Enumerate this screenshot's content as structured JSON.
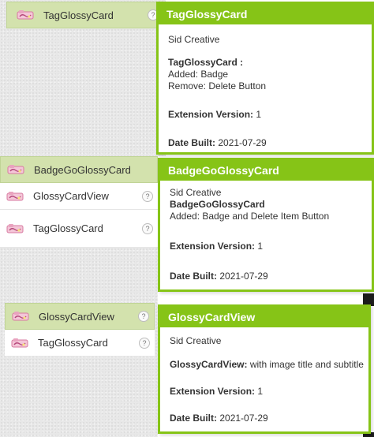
{
  "colors": {
    "accent": "#86c417",
    "selected_row": "#d3e2ad"
  },
  "icons": {
    "extension": "extension-icon",
    "help": "help-icon"
  },
  "section1": {
    "items": [
      {
        "label": "TagGlossyCard",
        "selected": true
      }
    ],
    "tooltip": {
      "title": "TagGlossyCard",
      "author": "Sid Creative",
      "desc_heading": "TagGlossyCard :",
      "desc_line1": "Added: Badge",
      "desc_line2": "Remove: Delete Button",
      "version_label": "Extension Version:",
      "version_value": "1",
      "date_label": "Date Built:",
      "date_value": "2021-07-29"
    }
  },
  "section2": {
    "items": [
      {
        "label": "BadgeGoGlossyCard",
        "selected": true
      },
      {
        "label": "GlossyCardView",
        "selected": false
      },
      {
        "label": "TagGlossyCard",
        "selected": false
      }
    ],
    "tooltip": {
      "title": "BadgeGoGlossyCard",
      "author": "Sid Creative",
      "desc_heading": "BadgeGoGlossyCard",
      "desc_line1": "Added: Badge and Delete Item Button",
      "version_label": "Extension Version:",
      "version_value": "1",
      "date_label": "Date Built:",
      "date_value": "2021-07-29"
    }
  },
  "section3": {
    "items": [
      {
        "label": "GlossyCardView",
        "selected": true
      },
      {
        "label": "TagGlossyCard",
        "selected": false
      }
    ],
    "tooltip": {
      "title": "GlossyCardView",
      "author": "Sid Creative",
      "desc_heading": "GlossyCardView:",
      "desc_line1": "with image title and subtitle",
      "version_label": "Extension Version:",
      "version_value": "1",
      "date_label": "Date Built:",
      "date_value": "2021-07-29"
    }
  }
}
